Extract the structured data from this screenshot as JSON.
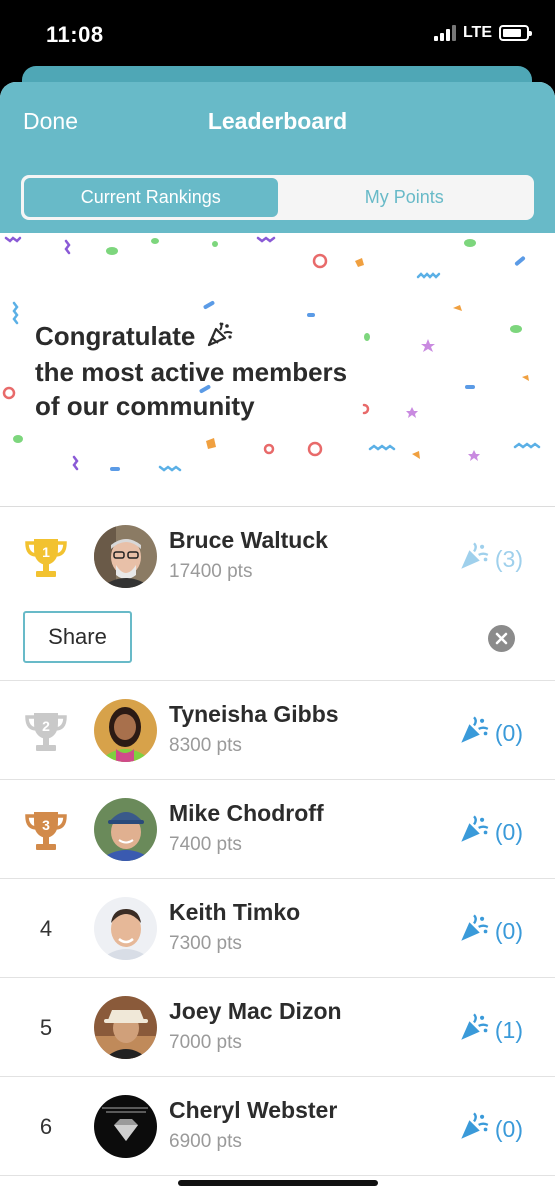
{
  "status_bar": {
    "time": "11:08",
    "network": "LTE"
  },
  "header": {
    "done_label": "Done",
    "title": "Leaderboard",
    "tabs": [
      {
        "label": "Current Rankings",
        "active": true
      },
      {
        "label": "My Points",
        "active": false
      }
    ]
  },
  "banner": {
    "line1": "Congratulate",
    "line2": "the most active members",
    "line3": "of our community"
  },
  "leaders": [
    {
      "rank": "1",
      "rank_type": "gold-trophy",
      "name": "Bruce Waltuck",
      "points": "17400 pts",
      "congrats": "(3)"
    },
    {
      "rank": "2",
      "rank_type": "silver-trophy",
      "name": "Tyneisha Gibbs",
      "points": "8300 pts",
      "congrats": "(0)"
    },
    {
      "rank": "3",
      "rank_type": "bronze-trophy",
      "name": "Mike Chodroff",
      "points": "7400 pts",
      "congrats": "(0)"
    },
    {
      "rank": "4",
      "rank_type": "number",
      "name": "Keith Timko",
      "points": "7300 pts",
      "congrats": "(0)"
    },
    {
      "rank": "5",
      "rank_type": "number",
      "name": "Joey Mac Dizon",
      "points": "7000 pts",
      "congrats": "(1)"
    },
    {
      "rank": "6",
      "rank_type": "number",
      "name": "Cheryl Webster",
      "points": "6900 pts",
      "congrats": "(0)"
    }
  ],
  "share_label": "Share",
  "colors": {
    "accent": "#68bac8",
    "congrats_blue": "#3a9ad9",
    "gold": "#f2c230",
    "silver": "#c9c9c9",
    "bronze": "#d28a4a"
  }
}
